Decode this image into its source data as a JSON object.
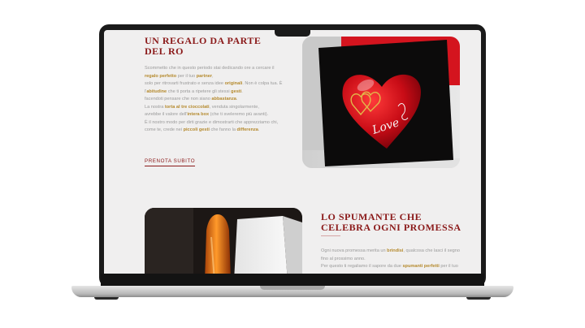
{
  "section1": {
    "title": "UN REGALO DA PARTE DEL RO",
    "cta_label": "PRENOTA SUBITO",
    "paragraph_lines": [
      [
        {
          "t": "Scommetto che in questo periodo stai dedicando ore a cercare il",
          "b": false
        }
      ],
      [
        {
          "t": "regalo perfetto",
          "b": true
        },
        {
          "t": " per il tuo ",
          "b": false
        },
        {
          "t": "partner",
          "b": true
        },
        {
          "t": ",",
          "b": false
        }
      ],
      [
        {
          "t": "solo per ritrovarti frustrato e senza idee ",
          "b": false
        },
        {
          "t": "originali",
          "b": true
        },
        {
          "t": ". Non è colpa tua. È",
          "b": false
        }
      ],
      [
        {
          "t": "l'",
          "b": false
        },
        {
          "t": "abitudine",
          "b": true
        },
        {
          "t": " che ti porta a ripetere gli stessi ",
          "b": false
        },
        {
          "t": "gesti",
          "b": true
        },
        {
          "t": ".",
          "b": false
        }
      ],
      [
        {
          "t": "facendoti pensare che non siano ",
          "b": false
        },
        {
          "t": "abbastanza",
          "b": true
        },
        {
          "t": ".",
          "b": false
        }
      ],
      [
        {
          "t": "La nostra ",
          "b": false
        },
        {
          "t": "torta al tre cioccolati",
          "b": true
        },
        {
          "t": ", venduta singolarmente,",
          "b": false
        }
      ],
      [
        {
          "t": "avrebbe il valore dell'",
          "b": false
        },
        {
          "t": "intera box",
          "b": true
        },
        {
          "t": " (che ti sveleremo più avanti).",
          "b": false
        }
      ],
      [
        {
          "t": "È il nostro modo per dirti grazie e dimostrarti che apprezziamo chi,",
          "b": false
        }
      ],
      [
        {
          "t": "come te, crede nei ",
          "b": false
        },
        {
          "t": "piccoli gesti",
          "b": true
        },
        {
          "t": " che fanno la ",
          "b": false
        },
        {
          "t": "differenza",
          "b": true
        },
        {
          "t": ".",
          "b": false
        }
      ]
    ]
  },
  "section2": {
    "title": "LO SPUMANTE CHE CELEBRA OGNI PROMESSA",
    "paragraph_lines": [
      [
        {
          "t": "Ogni nuova promessa merita un ",
          "b": false
        },
        {
          "t": "brindisi",
          "b": true
        },
        {
          "t": ", qualcosa che lasci il segno",
          "b": false
        }
      ],
      [
        {
          "t": "fino al prossimo anno.",
          "b": false
        }
      ],
      [
        {
          "t": "Per questo ti regaliamo il sapore da due ",
          "b": false
        },
        {
          "t": "spumanti perfetti",
          "b": true
        },
        {
          "t": " per il tuo",
          "b": false
        }
      ]
    ]
  },
  "images": {
    "image1_icon": "heart-cake-image",
    "image1_lettering": "Love",
    "image2_icon": "sparkling-wine-image"
  },
  "colors": {
    "accent": "#8b1a1a",
    "highlight": "#b58a2e",
    "body_text": "#9a9a9a",
    "screen_bg": "#f0efef"
  }
}
